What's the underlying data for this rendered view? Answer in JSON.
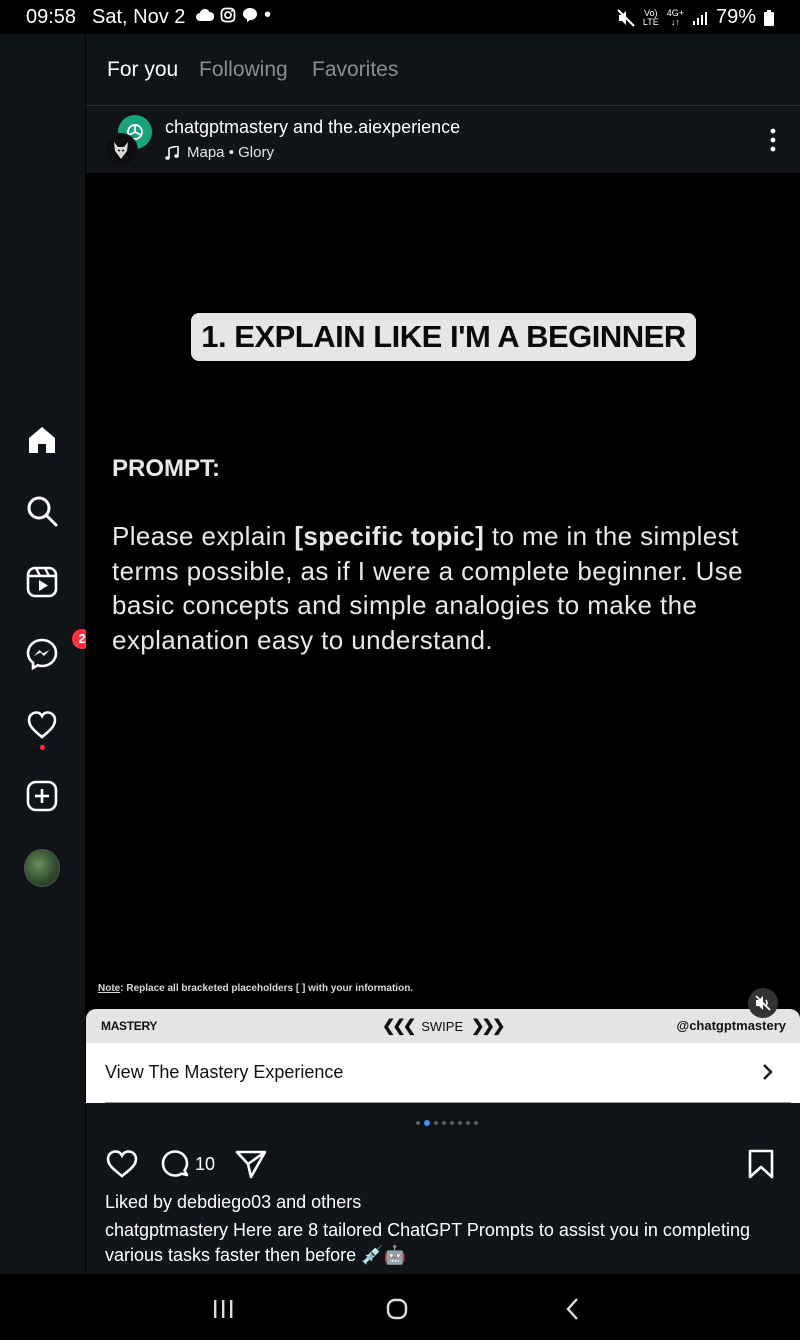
{
  "status_bar": {
    "time": "09:58",
    "date": "Sat, Nov 2",
    "volte_label": "Vo)",
    "lte_label": "LTE",
    "net_label": "4G+",
    "battery": "79%"
  },
  "nav": {
    "messages_badge": "2"
  },
  "tabs": [
    {
      "label": "For you",
      "active": true
    },
    {
      "label": "Following",
      "active": false
    },
    {
      "label": "Favorites",
      "active": false
    }
  ],
  "post": {
    "authors": "chatgptmastery and the.aiexperience",
    "audio": "Mapa • Glory",
    "media": {
      "title": "1. EXPLAIN LIKE I'M A BEGINNER",
      "prompt_label": "PROMPT:",
      "prompt_before": "Please explain ",
      "prompt_bold": "[specific topic]",
      "prompt_after": " to me in the simplest terms possible, as if I were a complete beginner. Use basic concepts and simple analogies to make the explanation easy to understand.",
      "note_label": "Note",
      "note_text": ": Replace all bracketed placeholders [ ] with your information.",
      "footer_left": "MASTERY",
      "footer_swipe": "SWIPE",
      "footer_handle": "@chatgptmastery"
    },
    "cta_label": "View The Mastery Experience",
    "carousel": {
      "total": 8,
      "current": 2
    },
    "comment_count": "10",
    "liked_by": "Liked by debdiego03 and others",
    "caption": "chatgptmastery Here are 8 tailored ChatGPT Prompts to assist you in completing various tasks faster then before 💉🤖"
  },
  "colors": {
    "background": "#101418",
    "badge": "#ff3040",
    "active_dot": "#3897f0",
    "openai_green": "#1aa37a"
  }
}
